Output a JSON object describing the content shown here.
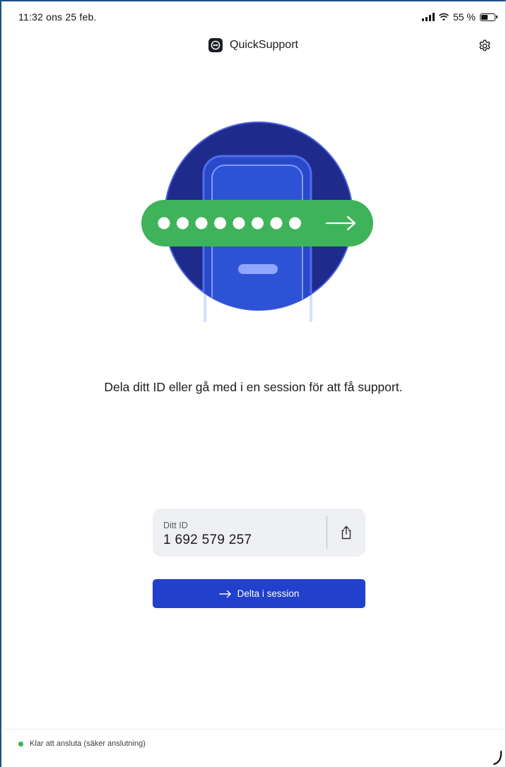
{
  "status_bar": {
    "time": "11:32  ons 25 feb.",
    "battery": "55 %",
    "battery_level": 0.55
  },
  "header": {
    "title": "QuickSupport",
    "logo_icon": "teamviewer-logo-icon",
    "settings_icon": "gear-icon"
  },
  "illustration": {
    "dots_count": 8,
    "arrow_icon": "arrow-right-icon"
  },
  "main": {
    "description": "Dela ditt ID eller gå med i en session för att få support."
  },
  "id_card": {
    "label": "Ditt ID",
    "value": "1 692 579 257",
    "share_icon": "share-icon"
  },
  "join_button": {
    "label": "Delta i session",
    "icon": "arrow-right-icon"
  },
  "footer": {
    "status_text": "Klar att ansluta (säker anslutning)",
    "status_color": "#37b24d"
  },
  "colors": {
    "accent": "#2140cc",
    "green_pill": "#3fb35a",
    "circle_dark": "#1f2b8a"
  }
}
